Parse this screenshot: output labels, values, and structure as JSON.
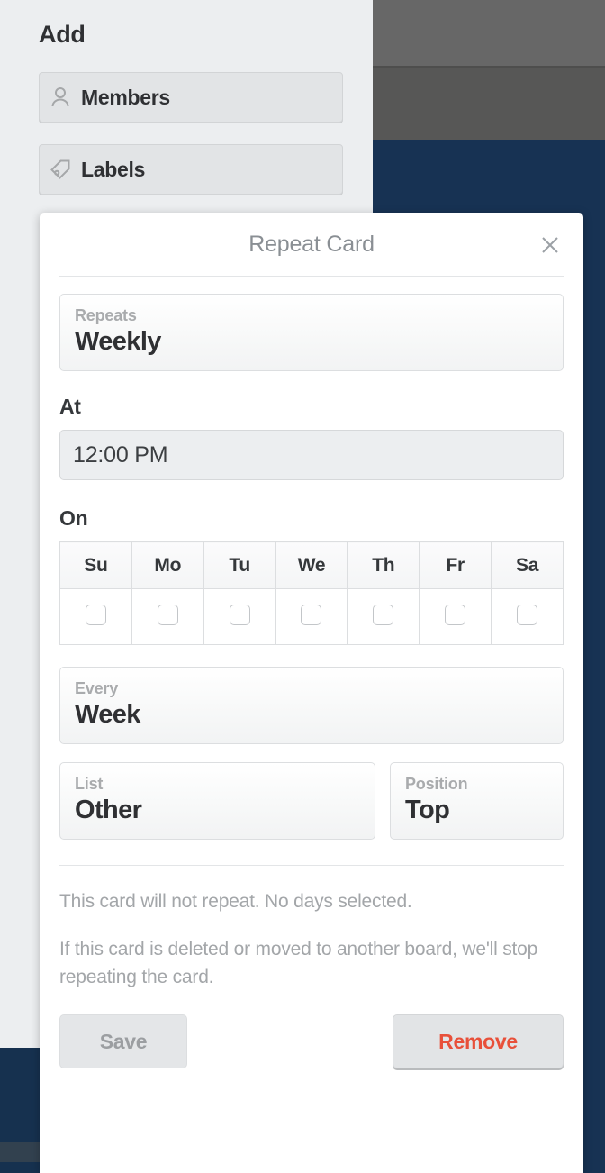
{
  "background": {
    "band_gray_top": "#676767",
    "band_gray_bottom": "#575756",
    "board_navy": "#173253",
    "board_slate": "#32414f"
  },
  "panel": {
    "title": "Add",
    "buttons": [
      {
        "label": "Members",
        "icon": "person-icon"
      },
      {
        "label": "Labels",
        "icon": "tag-icon"
      }
    ]
  },
  "modal": {
    "title": "Repeat Card",
    "close_icon": "close-icon",
    "repeats": {
      "label": "Repeats",
      "value": "Weekly"
    },
    "at": {
      "label": "At",
      "value": "12:00 PM",
      "placeholder": "12:00 PM"
    },
    "on": {
      "label": "On",
      "days": [
        {
          "abbr": "Su",
          "checked": false
        },
        {
          "abbr": "Mo",
          "checked": false
        },
        {
          "abbr": "Tu",
          "checked": false
        },
        {
          "abbr": "We",
          "checked": false
        },
        {
          "abbr": "Th",
          "checked": false
        },
        {
          "abbr": "Fr",
          "checked": false
        },
        {
          "abbr": "Sa",
          "checked": false
        }
      ]
    },
    "every": {
      "label": "Every",
      "value": "Week"
    },
    "list": {
      "label": "List",
      "value": "Other"
    },
    "position": {
      "label": "Position",
      "value": "Top"
    },
    "info_line_1": "This card will not repeat. No days selected.",
    "info_line_2": "If this card is deleted or moved to another board, we'll stop repeating the card.",
    "save_label": "Save",
    "remove_label": "Remove",
    "remove_color": "#e8503a"
  }
}
